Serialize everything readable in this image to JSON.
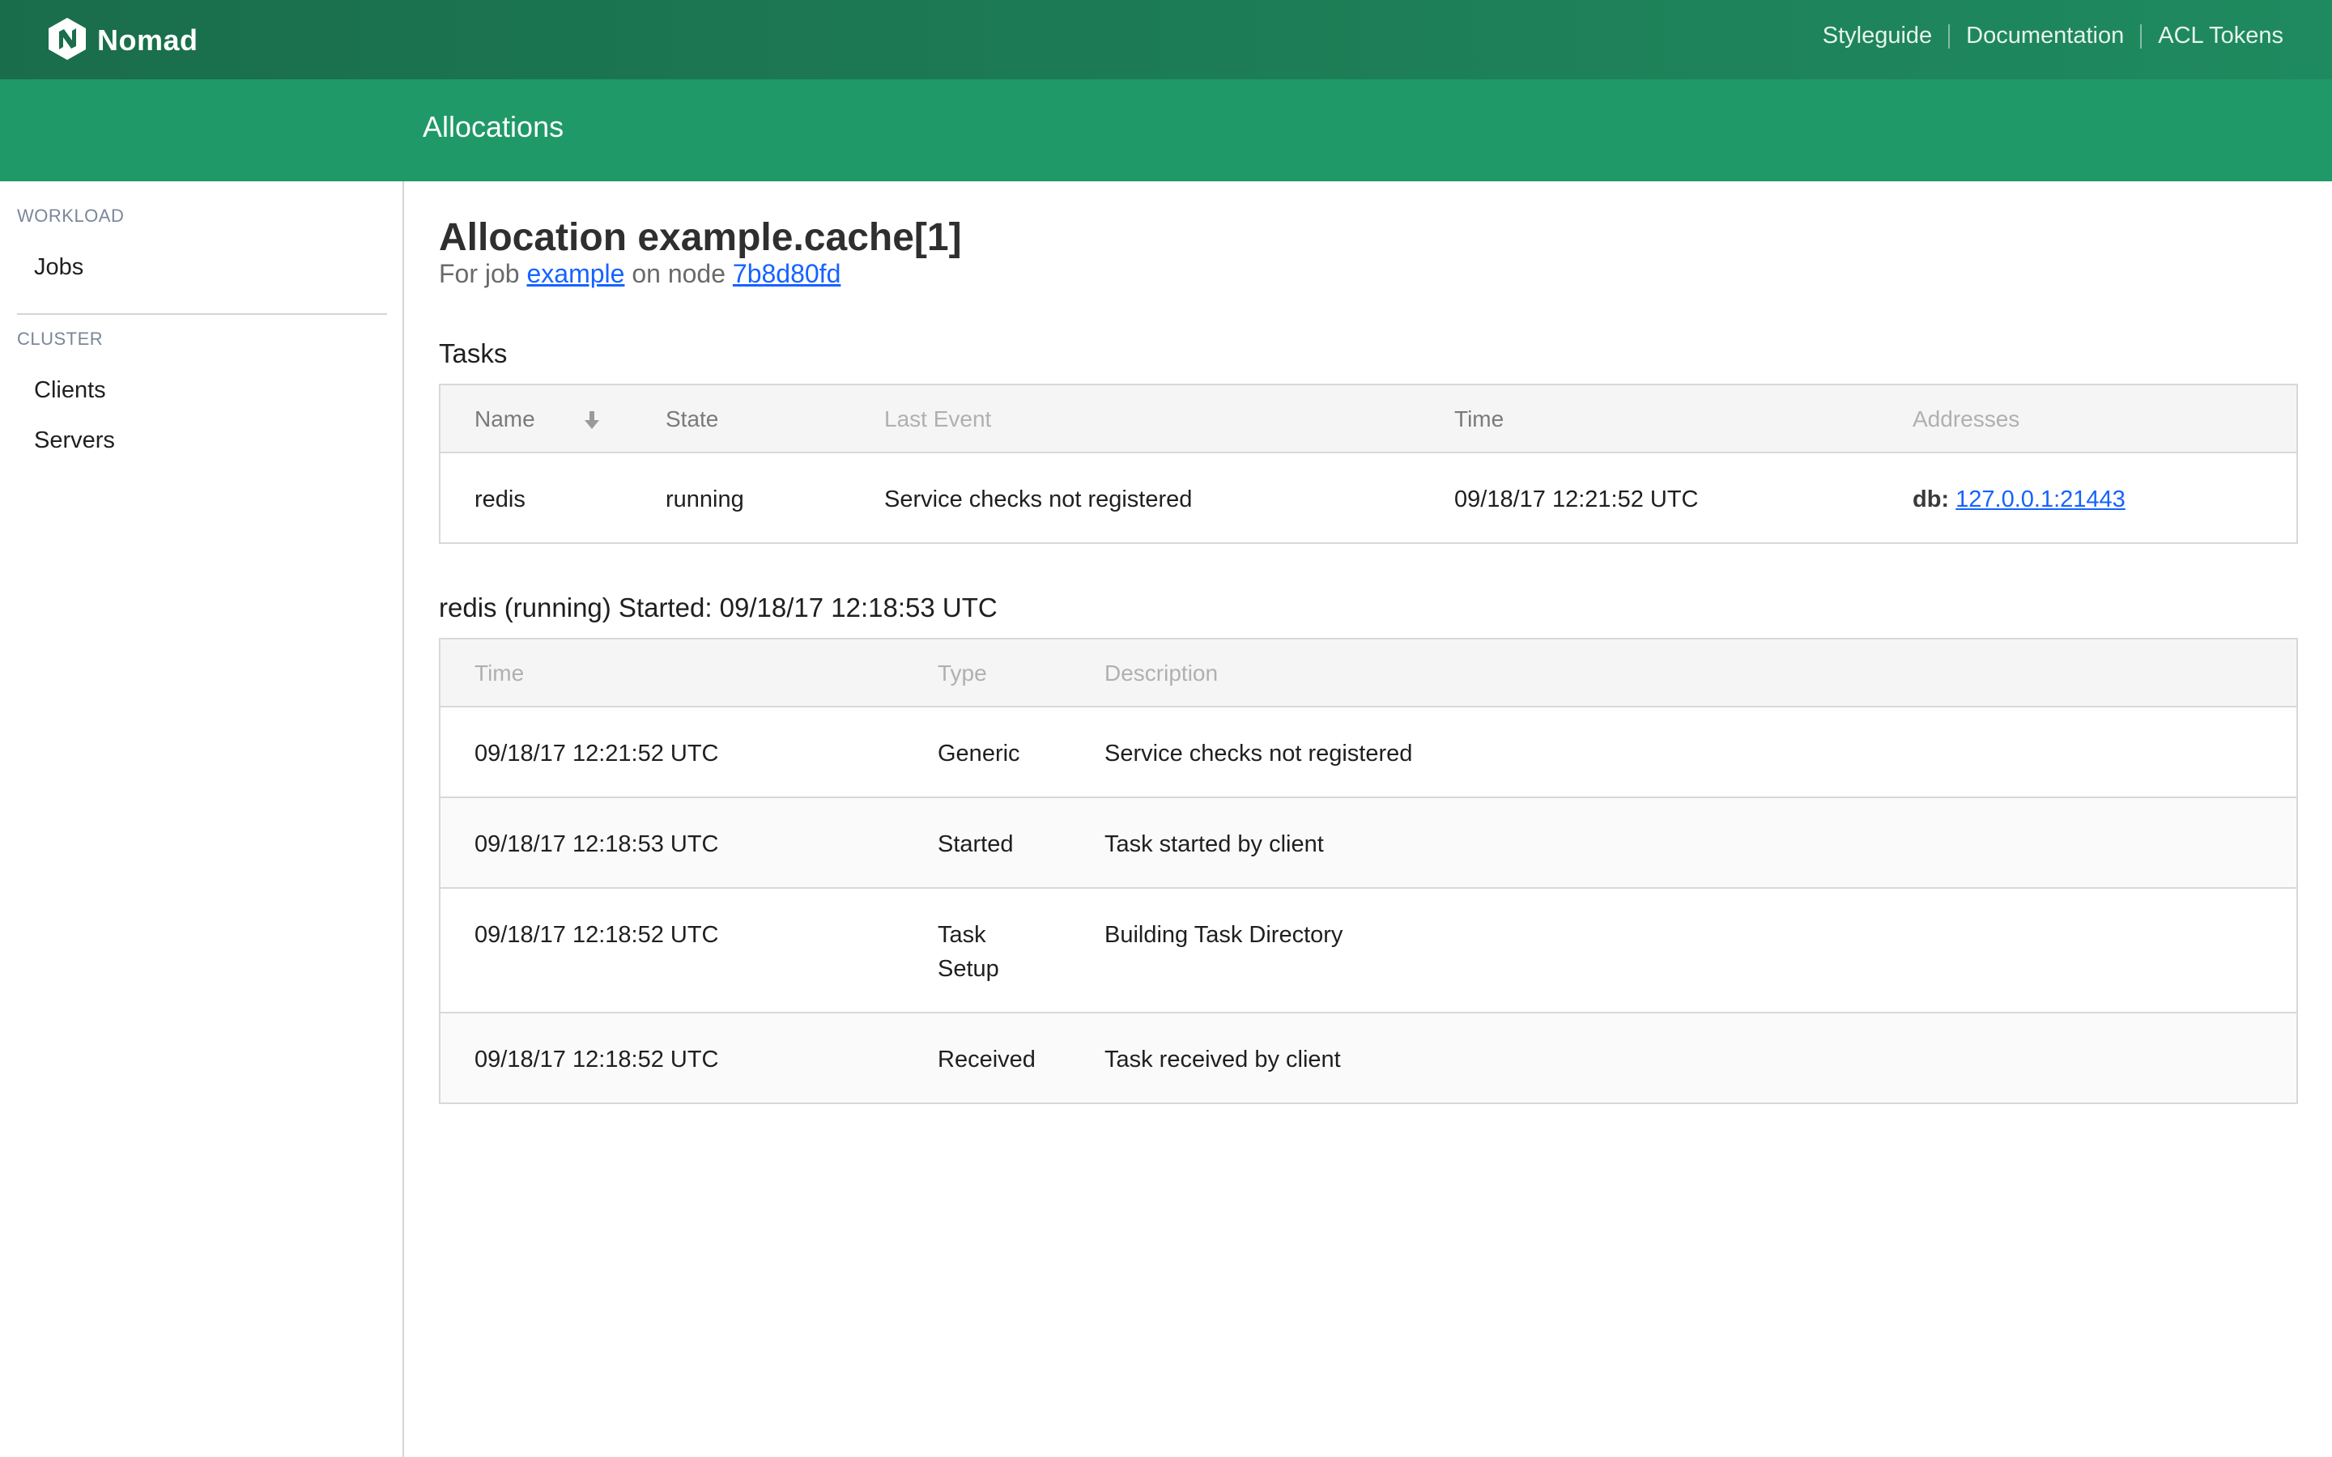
{
  "app": {
    "name": "Nomad"
  },
  "topnav": {
    "links": [
      "Styleguide",
      "Documentation",
      "ACL Tokens"
    ]
  },
  "subheader": {
    "title": "Allocations"
  },
  "sidebar": {
    "sections": [
      {
        "label": "WORKLOAD",
        "items": [
          "Jobs"
        ]
      },
      {
        "label": "CLUSTER",
        "items": [
          "Clients",
          "Servers"
        ]
      }
    ]
  },
  "allocation": {
    "title": "Allocation example.cache[1]",
    "for_job_prefix": "For job",
    "job": "example",
    "on_node_text": "on node",
    "node": "7b8d80fd"
  },
  "tasks": {
    "title": "Tasks",
    "columns": [
      "Name",
      "State",
      "Last Event",
      "Time",
      "Addresses"
    ],
    "sort_icon": "arrow-down-icon",
    "rows": [
      {
        "name": "redis",
        "state": "running",
        "last_event": "Service checks not registered",
        "time": "09/18/17 12:21:52 UTC",
        "address_key": "db:",
        "address_value": "127.0.0.1:21443"
      }
    ]
  },
  "events": {
    "title": "redis (running) Started: 09/18/17 12:18:53 UTC",
    "columns": [
      "Time",
      "Type",
      "Description"
    ],
    "rows": [
      {
        "time": "09/18/17 12:21:52 UTC",
        "type": "Generic",
        "description": "Service checks not registered"
      },
      {
        "time": "09/18/17 12:18:53 UTC",
        "type": "Started",
        "description": "Task started by client"
      },
      {
        "time": "09/18/17 12:18:52 UTC",
        "type": "Task Setup",
        "description": "Building Task Directory"
      },
      {
        "time": "09/18/17 12:18:52 UTC",
        "type": "Received",
        "description": "Task received by client"
      }
    ]
  },
  "colors": {
    "nav_start": "#1a6d4b",
    "nav_end": "#1f8a5f",
    "subheader": "#1f9967",
    "link": "#1563ff"
  }
}
